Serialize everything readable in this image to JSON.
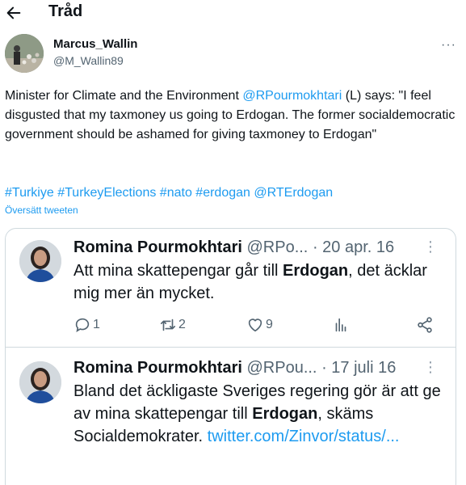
{
  "header": {
    "title": "Tråd",
    "back_icon": "arrow-left-icon"
  },
  "author": {
    "name": "Marcus_Wallin",
    "handle": "@M_Wallin89"
  },
  "tweet": {
    "text_prefix": "Minister for Climate and the Environment ",
    "mention": "@RPourmokhtari",
    "text_suffix": " (L) says: \"I feel disgusted that my taxmoney us going to Erdogan. The former socialdemocratic government should be ashamed for giving taxmoney to Erdogan\"",
    "hashtags": [
      "#Turkiye",
      "#TurkeyElections",
      "#nato",
      "#erdogan",
      "@RTErdogan"
    ],
    "translated_label": "Översätt tweeten"
  },
  "quotes": [
    {
      "name": "Romina Pourmokhtari",
      "handle": "@RPo...",
      "date": "· 20 apr. 16",
      "text_before": "Att mina skattepengar går till ",
      "text_bold": "Erdogan",
      "text_after": ", det äcklar mig mer än mycket.",
      "replies": "1",
      "retweets": "2",
      "likes": "9"
    },
    {
      "name": "Romina Pourmokhtari",
      "handle": "@RPou...",
      "date": "· 17 juli 16",
      "text_before": "Bland det äckligaste Sveriges regering gör är att ge av mina skattepengar till ",
      "text_bold": "Erdogan",
      "text_after": ", skäms Socialdemokrater. ",
      "link": "twitter.com/Zinvor/status/..."
    }
  ],
  "colors": {
    "accent": "#1d9bf0",
    "text": "#0f1419",
    "muted": "#536471",
    "border": "#cfd9de"
  }
}
